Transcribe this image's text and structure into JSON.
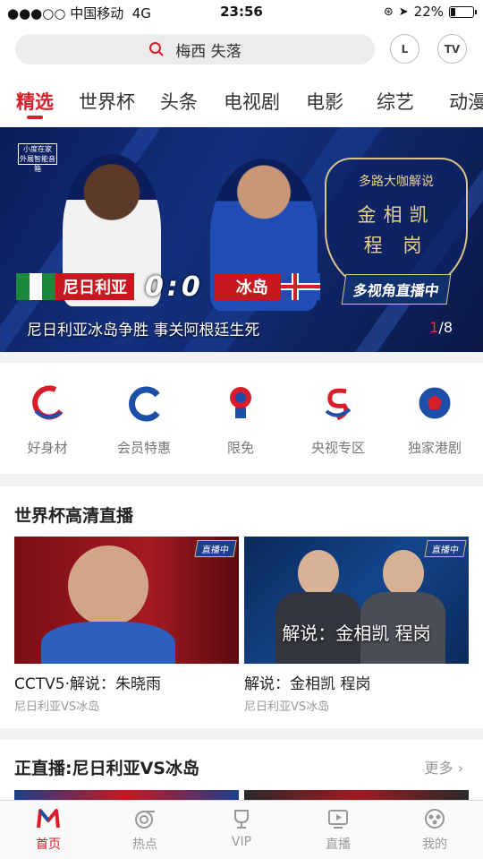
{
  "status_bar": {
    "carrier": "●●●○○ 中国移动",
    "network": "4G",
    "time": "23:56",
    "battery": "22%",
    "battery_level": 0.22
  },
  "search": {
    "text": "梅西 失落"
  },
  "header_buttons": {
    "history": "L",
    "tv": "TV"
  },
  "tabs": [
    "精选",
    "世界杯",
    "头条",
    "电视剧",
    "电影",
    "综艺",
    "动漫"
  ],
  "banner": {
    "title": "尼日利亚冰岛争胜 事关阿根廷生死",
    "page_current": "1",
    "page_total": "/8",
    "team_left": "尼日利亚",
    "team_right": "冰岛",
    "score": "0:0",
    "commentary_heading": "多路大咖解说",
    "commentators": [
      "金相凯",
      "程 岗"
    ],
    "multiview": "多视角直播中",
    "small_logo": "小度在家 外展智能音箱"
  },
  "quick_links": [
    {
      "label": "好身材",
      "icon": "fitness-icon"
    },
    {
      "label": "会员特惠",
      "icon": "member-icon"
    },
    {
      "label": "限免",
      "icon": "free-icon"
    },
    {
      "label": "央视专区",
      "icon": "cctv-icon"
    },
    {
      "label": "独家港剧",
      "icon": "hk-drama-icon"
    }
  ],
  "worldcup_section": {
    "title": "世界杯高清直播",
    "live_badge": "直播中",
    "cards": [
      {
        "title": "CCTV5·解说：朱晓雨",
        "subtitle": "尼日利亚VS冰岛"
      },
      {
        "title": "解说：金相凯 程岗",
        "subtitle": "尼日利亚VS冰岛",
        "overlay": "解说：金相凯 程岗"
      }
    ]
  },
  "live_section": {
    "title": "正直播:尼日利亚VS冰岛",
    "more": "更多"
  },
  "bottom_nav": [
    {
      "label": "首页",
      "icon": "home-icon"
    },
    {
      "label": "热点",
      "icon": "hot-icon"
    },
    {
      "label": "VIP",
      "icon": "vip-icon"
    },
    {
      "label": "直播",
      "icon": "live-icon"
    },
    {
      "label": "我的",
      "icon": "profile-icon"
    }
  ],
  "colors": {
    "accent": "#d81e2b",
    "banner_blue": "#13307e",
    "gold": "#d9c48a"
  }
}
